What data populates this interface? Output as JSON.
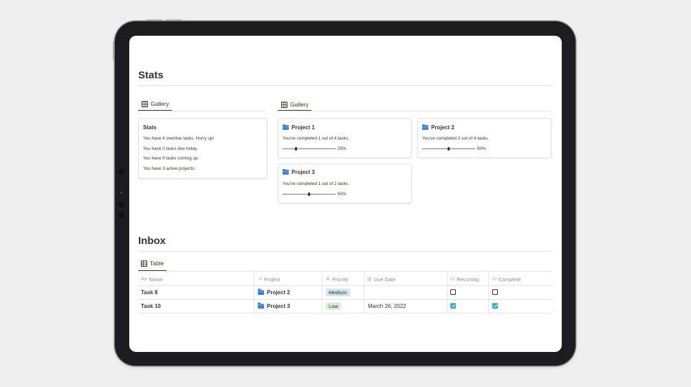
{
  "stats_section": {
    "title": "Stats",
    "left_view": {
      "tab_label": "Gallery",
      "card": {
        "title": "Stats",
        "lines": [
          "You have 4 overdue tasks. Hurry up!",
          "You have 0 tasks due today.",
          "You have 0 tasks coming up.",
          "You have 3 active projects."
        ]
      }
    },
    "right_view": {
      "tab_label": "Gallery",
      "cards": [
        {
          "title": "Project 1",
          "text": "You've completed 1 out of 4 tasks.",
          "progress_label": "25%",
          "progress": 0.25
        },
        {
          "title": "Project 2",
          "text": "You've completed 2 out of 4 tasks.",
          "progress_label": "50%",
          "progress": 0.5
        },
        {
          "title": "Project 3",
          "text": "You've completed 1 out of 2 tasks.",
          "progress_label": "50%",
          "progress": 0.5
        }
      ]
    }
  },
  "inbox_section": {
    "title": "Inbox",
    "tab_label": "Table",
    "columns": [
      "Name",
      "Project",
      "Priority",
      "Due Date",
      "Recurring",
      "Complete"
    ],
    "column_icons": [
      "text-icon",
      "relation-arrow-icon",
      "select-icon",
      "calendar-icon",
      "checkbox-icon",
      "checkbox-icon"
    ],
    "rows": [
      {
        "name": "Task 8",
        "project": "Project 2",
        "priority": "Medium",
        "due_date": "",
        "recurring": false,
        "complete": false
      },
      {
        "name": "Task 10",
        "project": "Project 3",
        "priority": "Low",
        "due_date": "March 26, 2022",
        "recurring": true,
        "complete": true
      }
    ]
  },
  "colors": {
    "folder": "#3b84d9",
    "checkbox_checked": "#2eaadc",
    "tag_medium_bg": "#d3e5ef",
    "tag_low_bg": "#dbeddb",
    "text": "#37352f",
    "muted": "#8e8d89"
  }
}
